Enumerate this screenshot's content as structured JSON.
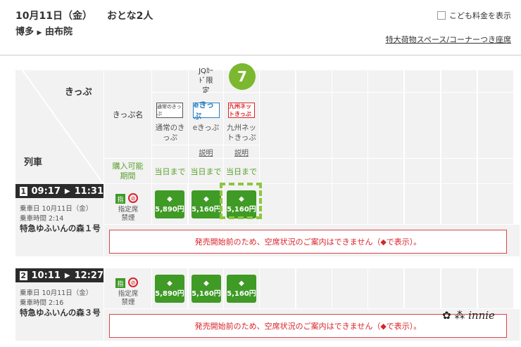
{
  "header": {
    "date": "10月11日（金）",
    "passengers": "おとな2人",
    "from": "博多",
    "to": "由布院",
    "child_fare_label": "こども料金を表示",
    "child_fare_checked": false,
    "luggage_link": "特大荷物スペース/コーナーつき座席"
  },
  "table": {
    "corner_ticket": "きっぷ",
    "corner_train": "列車",
    "ticket_name_label": "きっぷ名",
    "purchase_period_label": "購入可能期間",
    "jq_card_only": "JQｶｰﾄﾞ限定",
    "badge_number": "7",
    "tickets": [
      {
        "logo": "通常のきっぷ",
        "name": "通常のきっぷ",
        "explain": "",
        "period": "当日まで"
      },
      {
        "logo": "eきっぷ",
        "name": "eきっぷ",
        "explain": "説明",
        "period": "当日まで"
      },
      {
        "logo": "九州ネットきっぷ",
        "name": "九州ネットきっぷ",
        "explain": "説明",
        "period": "当日まで"
      }
    ]
  },
  "trains": [
    {
      "num": "1",
      "dep": "09:17",
      "arr": "11:31",
      "date_label": "乗車日 10月11日（金）",
      "duration_label": "乗車時間 2:14",
      "name": "特急ゆふいんの森１号",
      "seat_icon": "指",
      "seat_type": "指定席禁煙",
      "fares": [
        "5,890円",
        "5,160円",
        "5,160円"
      ],
      "message": "発売開始前のため、空席状況のご案内はできません（◆で表示）。"
    },
    {
      "num": "2",
      "dep": "10:11",
      "arr": "12:27",
      "date_label": "乗車日 10月11日（金）",
      "duration_label": "乗車時間 2:16",
      "name": "特急ゆふいんの森３号",
      "seat_icon": "指",
      "seat_type": "指定席禁煙",
      "fares": [
        "5,890円",
        "5,160円",
        "5,160円"
      ],
      "message": "発売開始前のため、空席状況のご案内はできません（◆で表示）。"
    }
  ],
  "fare_mark": "◆",
  "colors": {
    "green": "#3f9a26",
    "highlight": "#8cc63f",
    "error": "#d9232a"
  }
}
